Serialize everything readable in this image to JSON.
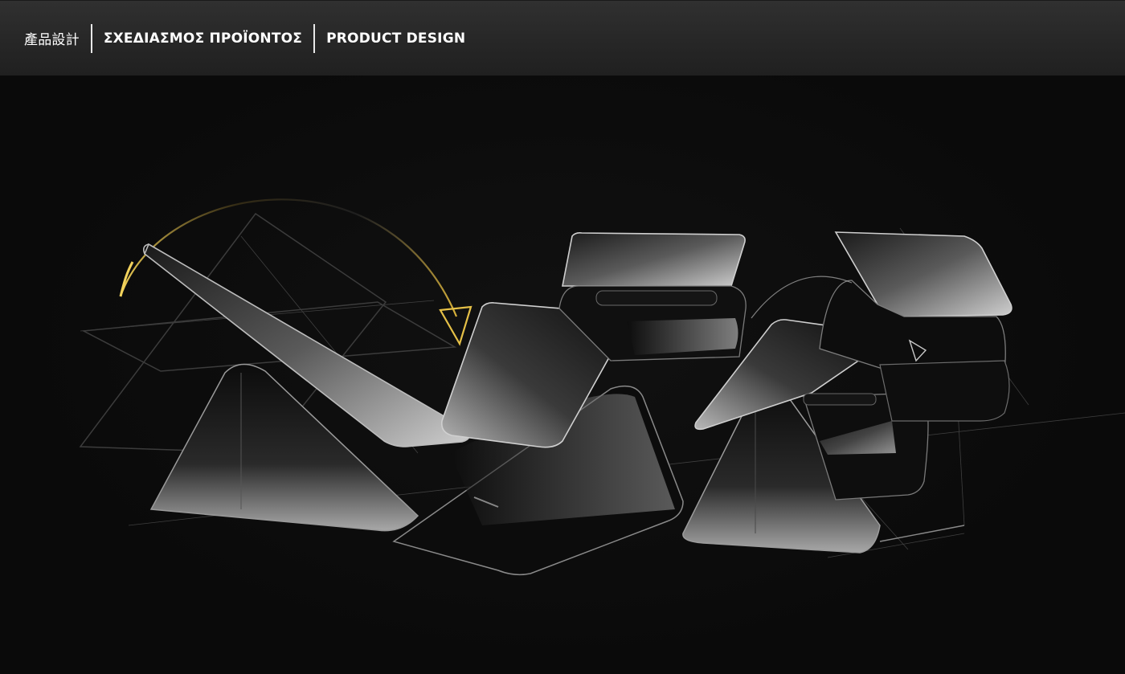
{
  "header": {
    "crumbs": [
      "產品設計",
      "ΣΧΕΔΙΑΣΜΟΣ ΠΡΟΪΟΝΤΟΣ",
      "PRODUCT DESIGN"
    ]
  },
  "colors": {
    "header_bg": "#262626",
    "stage_bg": "#0a0a0a",
    "accent_gold": "#d9b23a",
    "line_light": "#d8d8d8"
  }
}
